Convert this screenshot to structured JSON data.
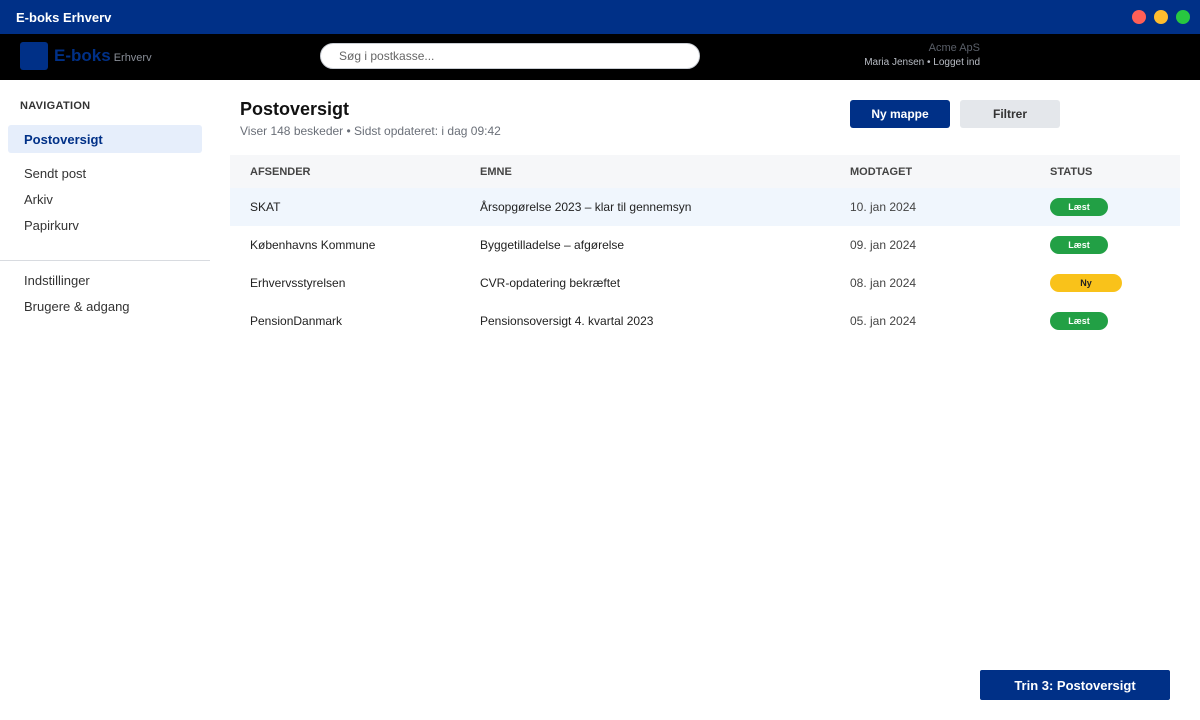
{
  "window": {
    "title": "E-boks Erhverv"
  },
  "appbar": {
    "logo_text": "E-boks",
    "logo_sub": "Erhverv",
    "search_placeholder": "Søg i postkasse...",
    "company": "Acme ApS",
    "user_status": "Maria Jensen • Logget ind"
  },
  "sidebar": {
    "heading": "NAVIGATION",
    "items": [
      {
        "label": "Postoversigt",
        "active": true
      },
      {
        "label": "Sendt post",
        "active": false
      },
      {
        "label": "Arkiv",
        "active": false
      },
      {
        "label": "Papirkurv",
        "active": false
      }
    ],
    "secondary_items": [
      {
        "label": "Indstillinger"
      },
      {
        "label": "Brugere & adgang"
      }
    ]
  },
  "main": {
    "title": "Postoversigt",
    "subtitle": "Viser 148 beskeder • Sidst opdateret: i dag 09:42",
    "primary_button": "Ny mappe",
    "secondary_button": "Filtrer"
  },
  "table": {
    "columns": [
      "AFSENDER",
      "EMNE",
      "MODTAGET",
      "STATUS"
    ],
    "rows": [
      {
        "sender": "SKAT",
        "subject": "Årsopgørelse 2023 – klar til gennemsyn",
        "received": "10. jan 2024",
        "status": "Læst"
      },
      {
        "sender": "Københavns Kommune",
        "subject": "Byggetilladelse – afgørelse",
        "received": "09. jan 2024",
        "status": "Læst"
      },
      {
        "sender": "Erhvervsstyrelsen",
        "subject": "CVR-opdatering bekræftet",
        "received": "08. jan 2024",
        "status": "Ny"
      },
      {
        "sender": "PensionDanmark",
        "subject": "Pensionsoversigt 4. kvartal 2023",
        "received": "05. jan 2024",
        "status": "Læst"
      }
    ]
  },
  "footer": {
    "step_button": "Trin 3: Postoversigt"
  },
  "colors": {
    "brand": "#003087",
    "status_read": "#22a045",
    "status_new": "#f9c21a"
  }
}
